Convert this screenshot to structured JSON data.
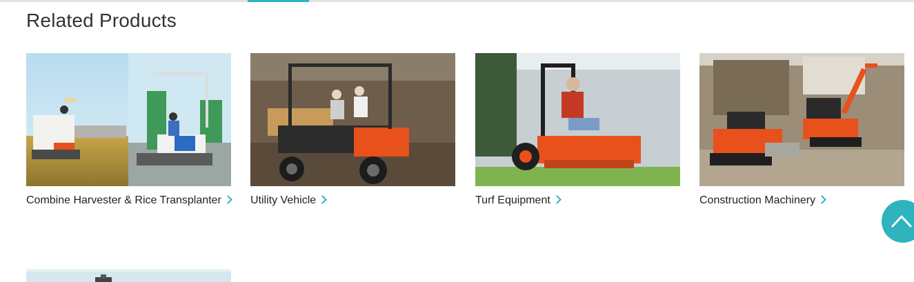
{
  "section": {
    "heading": "Related Products"
  },
  "products": [
    {
      "label": "Combine Harvester & Rice Transplanter",
      "image": "combine-harvester-rice-transplanter-photo"
    },
    {
      "label": "Utility Vehicle",
      "image": "utility-vehicle-photo"
    },
    {
      "label": "Turf Equipment",
      "image": "zero-turn-mower-photo"
    },
    {
      "label": "Construction Machinery",
      "image": "construction-machinery-photo"
    },
    {
      "label": "",
      "image": "partially-visible-product-photo"
    }
  ],
  "back_to_top": {
    "icon": "chevron-up-icon"
  },
  "colors": {
    "accent": "#2fb3bd",
    "heading_text": "#333333",
    "body_text": "#222222",
    "kubota_orange": "#e8501c"
  }
}
